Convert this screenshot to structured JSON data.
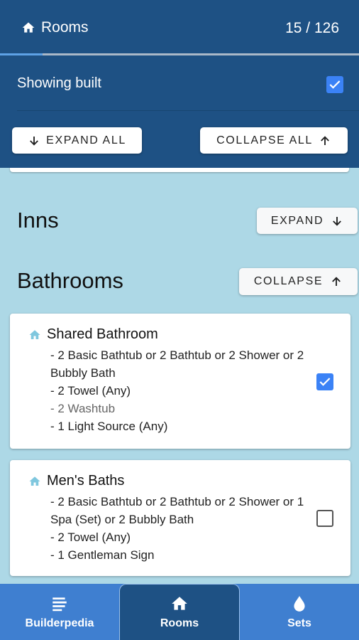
{
  "header": {
    "title": "Rooms",
    "count": "15 / 126",
    "progress_fraction": 0.119,
    "showing_built_label": "Showing built",
    "showing_built_checked": true,
    "expand_all_label": "EXPAND ALL",
    "collapse_all_label": "COLLAPSE ALL"
  },
  "sections": [
    {
      "title": "Inns",
      "button_label": "EXPAND"
    },
    {
      "title": "Bathrooms",
      "button_label": "COLLAPSE"
    }
  ],
  "rooms": [
    {
      "name": "Shared Bathroom",
      "requirements": [
        "- 2 Basic Bathtub or 2 Bathtub or 2 Shower or 2 Bubbly Bath",
        "- 2 Towel (Any)",
        "- 2 Washtub",
        "- 1 Light Source (Any)"
      ],
      "checked": true
    },
    {
      "name": "Men's Baths",
      "requirements": [
        "- 2 Basic Bathtub or 2 Bathtub or 2 Shower or 1 Spa (Set) or 2 Bubbly Bath",
        "- 2 Towel (Any)",
        "- 1 Gentleman Sign"
      ],
      "checked": false
    }
  ],
  "nav": {
    "items": [
      {
        "label": "Builderpedia",
        "icon": "book-icon"
      },
      {
        "label": "Rooms",
        "icon": "home-icon"
      },
      {
        "label": "Sets",
        "icon": "drop-icon"
      }
    ]
  },
  "colors": {
    "header_bg": "#1e5184",
    "page_bg": "#add8e6",
    "nav_bg": "#3f7fd0",
    "checkbox_accent": "#3b82f6",
    "room_icon": "#7fc7de"
  }
}
